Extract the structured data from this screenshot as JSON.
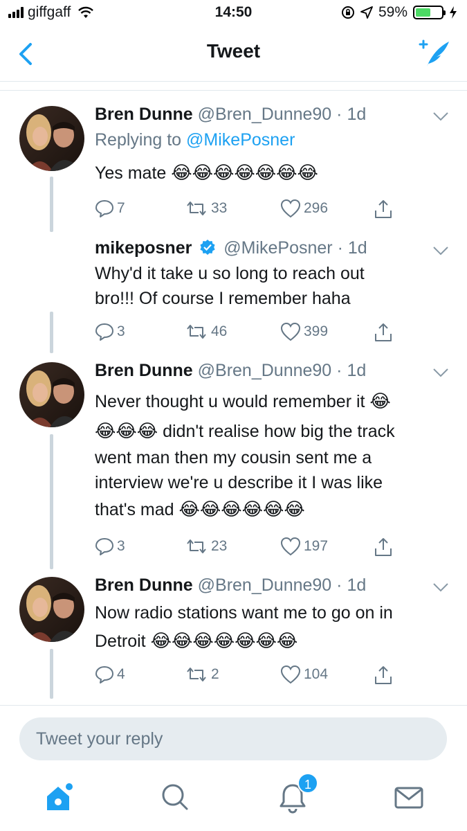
{
  "status_bar": {
    "carrier": "giffgaff",
    "time": "14:50",
    "battery_percent": "59%",
    "battery_level": 0.59
  },
  "nav": {
    "title": "Tweet",
    "back_icon": "chevron-left-icon",
    "compose_icon": "compose-tweet-icon"
  },
  "tweets": [
    {
      "name": "Bren Dunne",
      "handle": "@Bren_Dunne90",
      "time": "· 1d",
      "replying_prefix": "Replying to",
      "replying_to": "@MikePosner",
      "text": "Yes mate",
      "emoji": "😂😂😂😂😂😂😂",
      "replies": "7",
      "retweets": "33",
      "likes": "296"
    },
    {
      "name": "mikeposner",
      "verified": true,
      "handle": "@MikePosner",
      "time": "· 1d",
      "text_line1": "Why'd it take u so long to reach out",
      "text_line2": "bro!!! Of course I remember haha",
      "replies": "3",
      "retweets": "46",
      "likes": "399"
    },
    {
      "name": "Bren Dunne",
      "handle": "@Bren_Dunne90",
      "time": "· 1d",
      "text_line1": "Never thought u would remember it",
      "emoji1": "😂",
      "emoji2": "😂😂😂",
      "text_line2": "didn't realise how big the track",
      "text_line3": "went man then my cousin sent me a",
      "text_line4": "interview we're u describe it I was like",
      "text_line5": "that's mad",
      "emoji3": "😂😂😂😂😂😂",
      "replies": "3",
      "retweets": "23",
      "likes": "197"
    },
    {
      "name": "Bren Dunne",
      "handle": "@Bren_Dunne90",
      "time": "· 1d",
      "text_line1": "Now radio stations want me to go on in",
      "text_line2": "Detroit",
      "emoji": "😂😂😂😂😂😂😂",
      "replies": "4",
      "retweets": "2",
      "likes": "104"
    }
  ],
  "reply_box": {
    "placeholder": "Tweet your reply"
  },
  "tab_bar": {
    "tabs": [
      "home-icon",
      "search-icon",
      "notifications-icon",
      "messages-icon"
    ],
    "notification_count": "1"
  },
  "colors": {
    "accent": "#1da1f2",
    "muted": "#657786",
    "text": "#14171a"
  }
}
